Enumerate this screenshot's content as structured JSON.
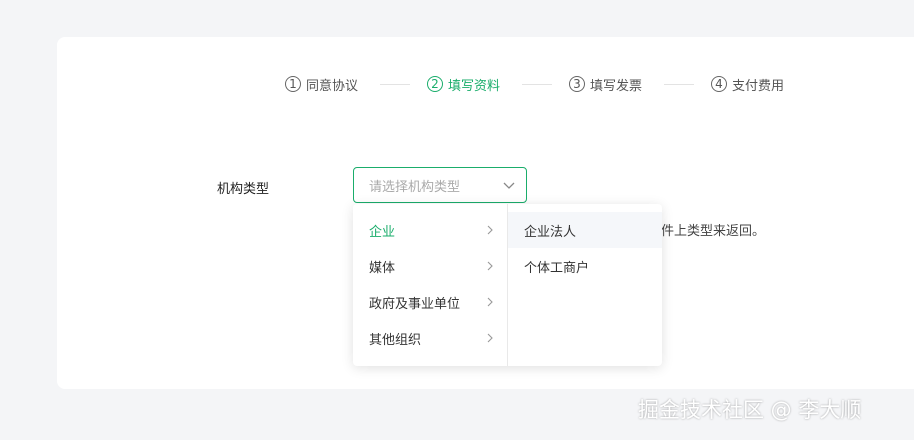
{
  "steps": [
    {
      "num": "1",
      "label": "同意协议"
    },
    {
      "num": "2",
      "label": "填写资料"
    },
    {
      "num": "3",
      "label": "填写发票"
    },
    {
      "num": "4",
      "label": "支付费用"
    }
  ],
  "active_step": 2,
  "form": {
    "org_type_label": "机构类型",
    "org_type_placeholder": "请选择机构类型",
    "hint_partial": "件上类型来返回。"
  },
  "cascader": {
    "level1": [
      "企业",
      "媒体",
      "政府及事业单位",
      "其他组织"
    ],
    "level1_selected": "企业",
    "level2": [
      "企业法人",
      "个体工商户"
    ],
    "level2_hovered": "企业法人"
  },
  "colors": {
    "accent": "#1aad6b",
    "background": "#f4f5f7"
  },
  "watermark": "掘金技术社区 @ 李大顺"
}
